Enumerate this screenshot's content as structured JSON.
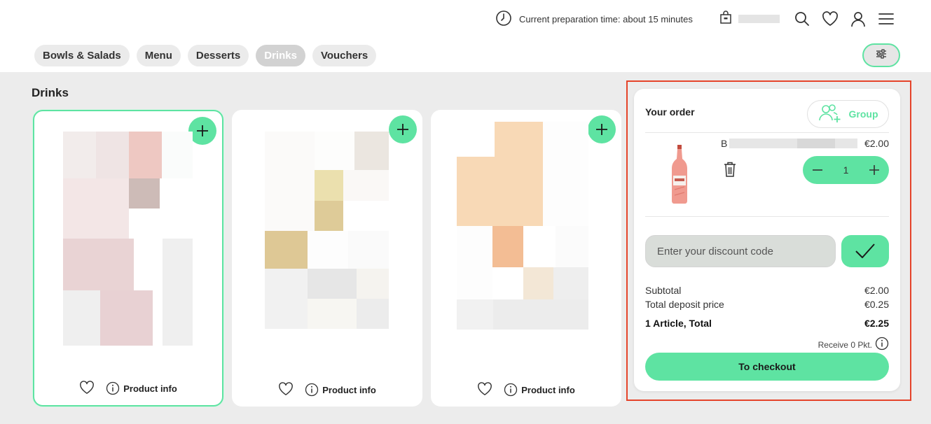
{
  "header": {
    "preparation_time": "Current preparation time: about 15 minutes",
    "icons": [
      "clock-icon",
      "shopping-bag-icon",
      "search-icon",
      "heart-icon",
      "user-icon",
      "menu-icon"
    ]
  },
  "tabs": [
    {
      "label": "Bowls & Salads",
      "active": false
    },
    {
      "label": "Menu",
      "active": false
    },
    {
      "label": "Desserts",
      "active": false
    },
    {
      "label": "Drinks",
      "active": true
    },
    {
      "label": "Vouchers",
      "active": false
    }
  ],
  "main": {
    "section_title": "Drinks",
    "products": [
      {
        "info_label": "Product info",
        "selected": true
      },
      {
        "info_label": "Product info",
        "selected": false
      },
      {
        "info_label": "Product info",
        "selected": false
      }
    ]
  },
  "order": {
    "title": "Your order",
    "group_label": "Group",
    "item": {
      "name_initial": "B",
      "price": "€2.00",
      "quantity": "1"
    },
    "discount_placeholder": "Enter your discount code",
    "subtotal_label": "Subtotal",
    "subtotal_value": "€2.00",
    "deposit_label": "Total deposit price",
    "deposit_value": "€0.25",
    "total_label": "1 Article, Total",
    "total_value": "€2.25",
    "points_label": "Receive 0 Pkt.",
    "checkout_label": "To checkout"
  },
  "colors": {
    "accent": "#5ee3a2",
    "highlight_border": "#e5442a",
    "content_bg": "#ececec"
  }
}
